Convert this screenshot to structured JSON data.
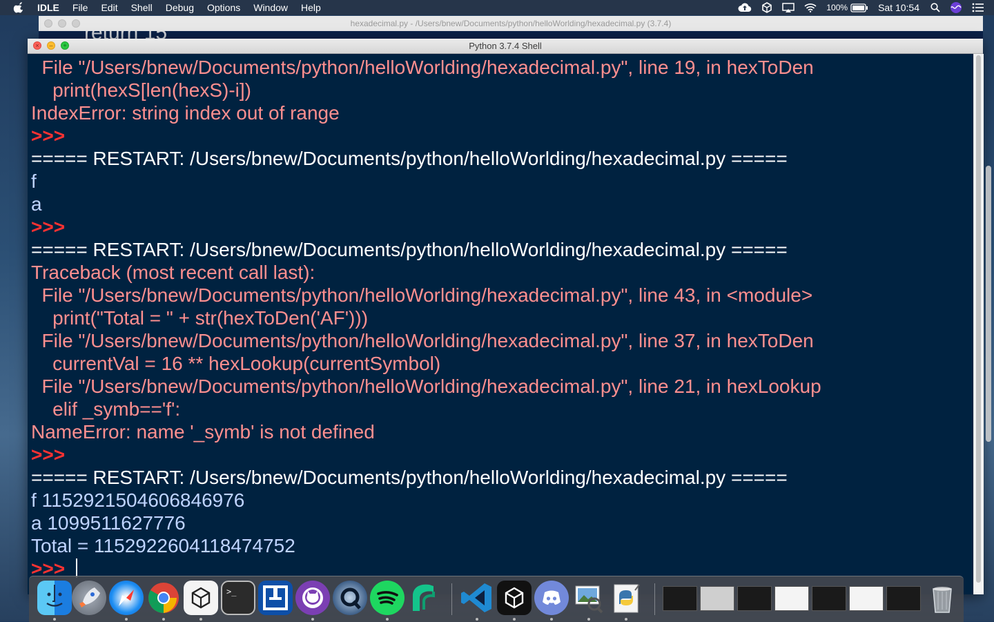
{
  "menubar": {
    "app_name": "IDLE",
    "items": [
      "File",
      "Edit",
      "Shell",
      "Debug",
      "Options",
      "Window",
      "Help"
    ],
    "battery": "100%",
    "clock": "Sat 10:54"
  },
  "background_window": {
    "title": "hexadecimal.py - /Users/bnew/Documents/python/helloWorlding/hexadecimal.py (3.7.4)",
    "peek_text": "return 15"
  },
  "shell_window": {
    "title": "Python 3.7.4 Shell",
    "lines": [
      {
        "text": "  File \"/Users/bnew/Documents/python/helloWorlding/hexadecimal.py\", line 19, in hexToDen",
        "kind": "err"
      },
      {
        "text": "    print(hexS[len(hexS)-i])",
        "kind": "err"
      },
      {
        "text": "IndexError: string index out of range",
        "kind": "err"
      },
      {
        "text": ">>> ",
        "kind": "prompt"
      },
      {
        "text": "===== RESTART: /Users/bnew/Documents/python/helloWorlding/hexadecimal.py =====",
        "kind": "restart"
      },
      {
        "text": "f",
        "kind": "out"
      },
      {
        "text": "a",
        "kind": "out"
      },
      {
        "text": ">>> ",
        "kind": "prompt"
      },
      {
        "text": "===== RESTART: /Users/bnew/Documents/python/helloWorlding/hexadecimal.py =====",
        "kind": "restart"
      },
      {
        "text": "Traceback (most recent call last):",
        "kind": "err"
      },
      {
        "text": "  File \"/Users/bnew/Documents/python/helloWorlding/hexadecimal.py\", line 43, in <module>",
        "kind": "err"
      },
      {
        "text": "    print(\"Total = \" + str(hexToDen('AF')))",
        "kind": "err"
      },
      {
        "text": "  File \"/Users/bnew/Documents/python/helloWorlding/hexadecimal.py\", line 37, in hexToDen",
        "kind": "err"
      },
      {
        "text": "    currentVal = 16 ** hexLookup(currentSymbol)",
        "kind": "err"
      },
      {
        "text": "  File \"/Users/bnew/Documents/python/helloWorlding/hexadecimal.py\", line 21, in hexLookup",
        "kind": "err"
      },
      {
        "text": "    elif _symb=='f':",
        "kind": "err"
      },
      {
        "text": "NameError: name '_symb' is not defined",
        "kind": "err"
      },
      {
        "text": ">>> ",
        "kind": "prompt"
      },
      {
        "text": "===== RESTART: /Users/bnew/Documents/python/helloWorlding/hexadecimal.py =====",
        "kind": "restart"
      },
      {
        "text": "f 1152921504606846976",
        "kind": "out"
      },
      {
        "text": "a 1099511627776",
        "kind": "out"
      },
      {
        "text": "Total = 1152922604118474752",
        "kind": "out"
      },
      {
        "text": ">>> ",
        "kind": "prompt",
        "cursor": true
      }
    ]
  },
  "colors": {
    "shell_bg": "#002240",
    "error_text": "#ff8f8f",
    "prompt": "#ff3232",
    "restart": "#ffffff",
    "output": "#bfd4ff"
  },
  "dock": {
    "apps": [
      "finder-icon",
      "launchpad-icon",
      "safari-icon",
      "chrome-icon",
      "unity-hub-icon",
      "terminal-icon",
      "sourcetree-icon",
      "github-desktop-icon",
      "quicktime-icon",
      "spotify-icon",
      "sublime-icon",
      "vscode-icon",
      "unity-icon",
      "discord-icon",
      "preview-icon",
      "python-launcher-icon"
    ],
    "minimized": [
      "vscode-window",
      "unity-window",
      "spotify-window",
      "github-window",
      "discord-window",
      "document-window",
      "chrome-window"
    ],
    "trash": "trash-icon"
  }
}
